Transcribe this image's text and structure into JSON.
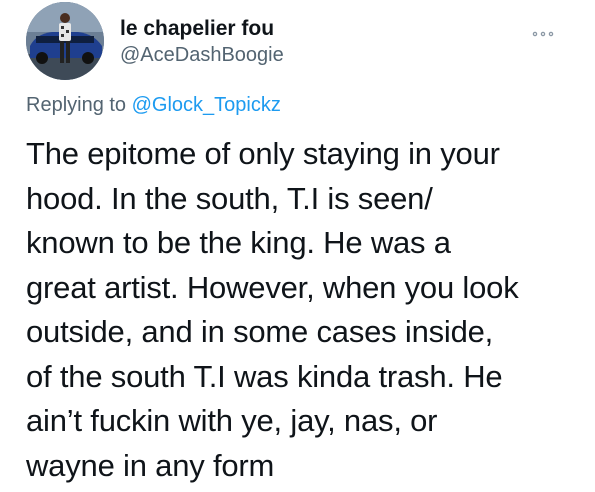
{
  "tweet": {
    "author": {
      "display_name": "le chapelier fou",
      "handle": "@AceDashBoogie",
      "avatar": "profile-photo"
    },
    "more_icon": "more-horizontal-icon",
    "reply": {
      "prefix": "Replying to",
      "mention": "@Glock_Topickz"
    },
    "text_lines": [
      "The epitome of only staying in your",
      "hood. In the south, T.I is seen/",
      "known to be the king. He was a",
      "great artist. However, when you look",
      "outside, and in some cases inside,",
      "of the south T.I was kinda trash. He",
      "ain’t fuckin with ye, jay, nas, or",
      "wayne in any form"
    ]
  },
  "colors": {
    "text_primary": "#0f1419",
    "text_secondary": "#536471",
    "link": "#1d9bf0",
    "background": "#ffffff"
  }
}
